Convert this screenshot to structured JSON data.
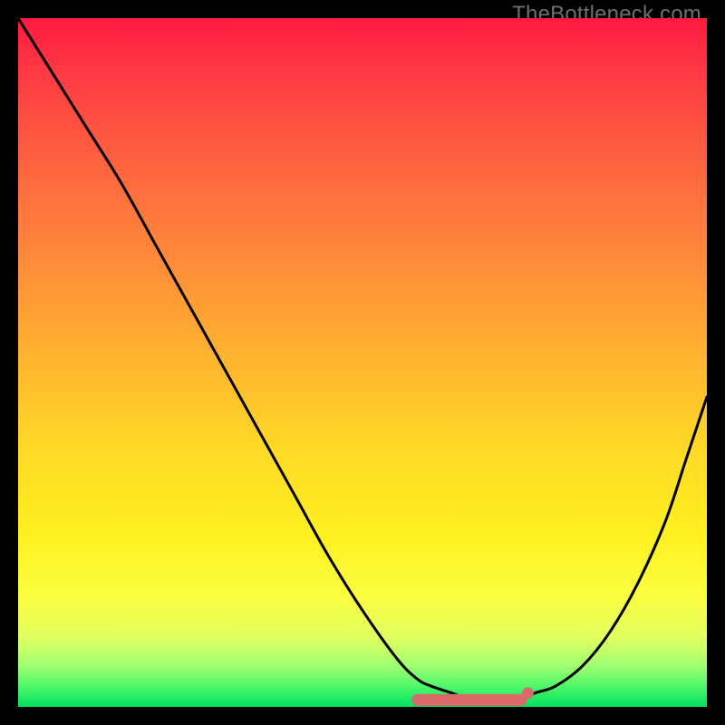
{
  "watermark": "TheBottleneck.com",
  "chart_data": {
    "type": "line",
    "title": "",
    "xlabel": "",
    "ylabel": "",
    "xlim": [
      0,
      100
    ],
    "ylim": [
      0,
      100
    ],
    "series": [
      {
        "name": "bottleneck-curve",
        "x": [
          0,
          5,
          10,
          15,
          20,
          25,
          30,
          35,
          40,
          45,
          50,
          55,
          58,
          60,
          63,
          66,
          70,
          73,
          75,
          78,
          82,
          86,
          90,
          94,
          97,
          100
        ],
        "y": [
          100,
          92,
          84,
          76,
          67,
          58,
          49,
          40,
          31,
          22,
          14,
          7,
          4,
          3,
          2,
          1,
          1,
          1,
          2,
          3,
          6,
          11,
          18,
          27,
          36,
          45
        ]
      }
    ],
    "markers": [
      {
        "name": "flat-min-band",
        "x_start": 58,
        "x_end": 73,
        "y": 1
      },
      {
        "name": "elbow-dot",
        "x": 74,
        "y": 2
      }
    ],
    "gradient_stops": [
      {
        "pct": 0,
        "color": "#ff1a40"
      },
      {
        "pct": 50,
        "color": "#ffc828"
      },
      {
        "pct": 85,
        "color": "#fcff3a"
      },
      {
        "pct": 100,
        "color": "#00e060"
      }
    ]
  }
}
